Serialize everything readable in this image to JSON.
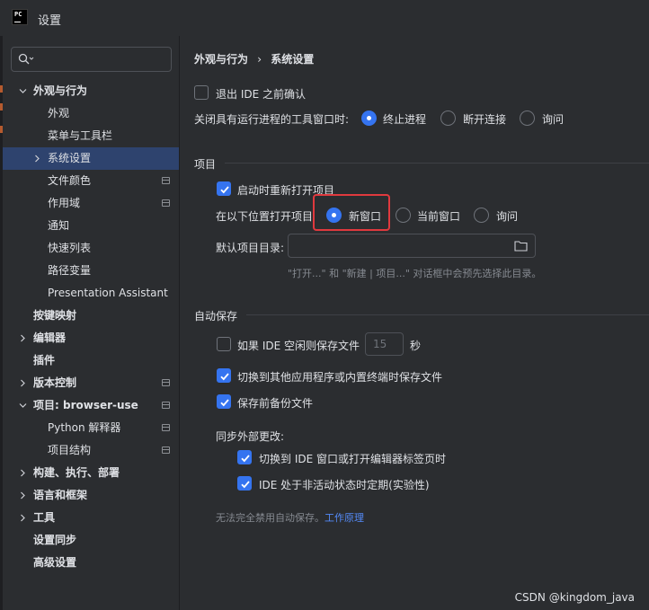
{
  "window": {
    "title": "设置"
  },
  "sidebar": {
    "search_placeholder": "",
    "items": [
      {
        "label": "外观与行为",
        "bold": true,
        "expanded": true
      },
      {
        "label": "外观"
      },
      {
        "label": "菜单与工具栏"
      },
      {
        "label": "系统设置",
        "selected": true
      },
      {
        "label": "文件颜色",
        "project_icon": true
      },
      {
        "label": "作用域",
        "project_icon": true
      },
      {
        "label": "通知"
      },
      {
        "label": "快速列表"
      },
      {
        "label": "路径变量"
      },
      {
        "label": "Presentation Assistant"
      },
      {
        "label": "按键映射",
        "bold": true
      },
      {
        "label": "编辑器",
        "bold": true
      },
      {
        "label": "插件",
        "bold": true
      },
      {
        "label": "版本控制",
        "bold": true,
        "project_icon": true
      },
      {
        "label": "项目: browser-use",
        "bold": true,
        "expanded": true,
        "project_icon": true
      },
      {
        "label": "Python 解释器",
        "project_icon": true
      },
      {
        "label": "项目结构",
        "project_icon": true
      },
      {
        "label": "构建、执行、部署",
        "bold": true
      },
      {
        "label": "语言和框架",
        "bold": true
      },
      {
        "label": "工具",
        "bold": true
      },
      {
        "label": "设置同步",
        "bold": true
      },
      {
        "label": "高级设置",
        "bold": true
      }
    ]
  },
  "breadcrumb": {
    "parent": "外观与行为",
    "separator": "›",
    "current": "系统设置"
  },
  "general": {
    "confirm_exit_label": "退出 IDE 之前确认",
    "confirm_exit_checked": false,
    "close_process_label": "关闭具有运行进程的工具窗口时:",
    "close_process_options": [
      "终止进程",
      "断开连接",
      "询问"
    ],
    "close_process_selected": 0
  },
  "project": {
    "section_title": "项目",
    "reopen_label": "启动时重新打开项目",
    "reopen_checked": true,
    "open_in_label": "在以下位置打开项目",
    "open_in_options": [
      "新窗口",
      "当前窗口",
      "询问"
    ],
    "open_in_selected": 0,
    "default_dir_label": "默认项目目录:",
    "default_dir_value": "",
    "default_dir_hint": "\"打开...\" 和 \"新建 | 项目...\" 对话框中会预先选择此目录。"
  },
  "autosave": {
    "section_title": "自动保存",
    "idle_save_label": "如果 IDE 空闲则保存文件",
    "idle_save_checked": false,
    "idle_seconds": "15",
    "idle_unit": "秒",
    "switch_app_label": "切换到其他应用程序或内置终端时保存文件",
    "switch_app_checked": true,
    "backup_label": "保存前备份文件",
    "backup_checked": true,
    "sync_title": "同步外部更改:",
    "sync_switch_label": "切换到 IDE 窗口或打开编辑器标签页时",
    "sync_switch_checked": true,
    "sync_periodic_label": "IDE 处于非活动状态时定期(实验性)",
    "sync_periodic_checked": true,
    "note_text": "无法完全禁用自动保存。",
    "note_link": "工作原理"
  },
  "watermark": "CSDN @kingdom_java",
  "colors": {
    "accent": "#3574f0",
    "highlight": "#e0393e",
    "background": "#2b2d30",
    "selection": "#2e436e"
  }
}
